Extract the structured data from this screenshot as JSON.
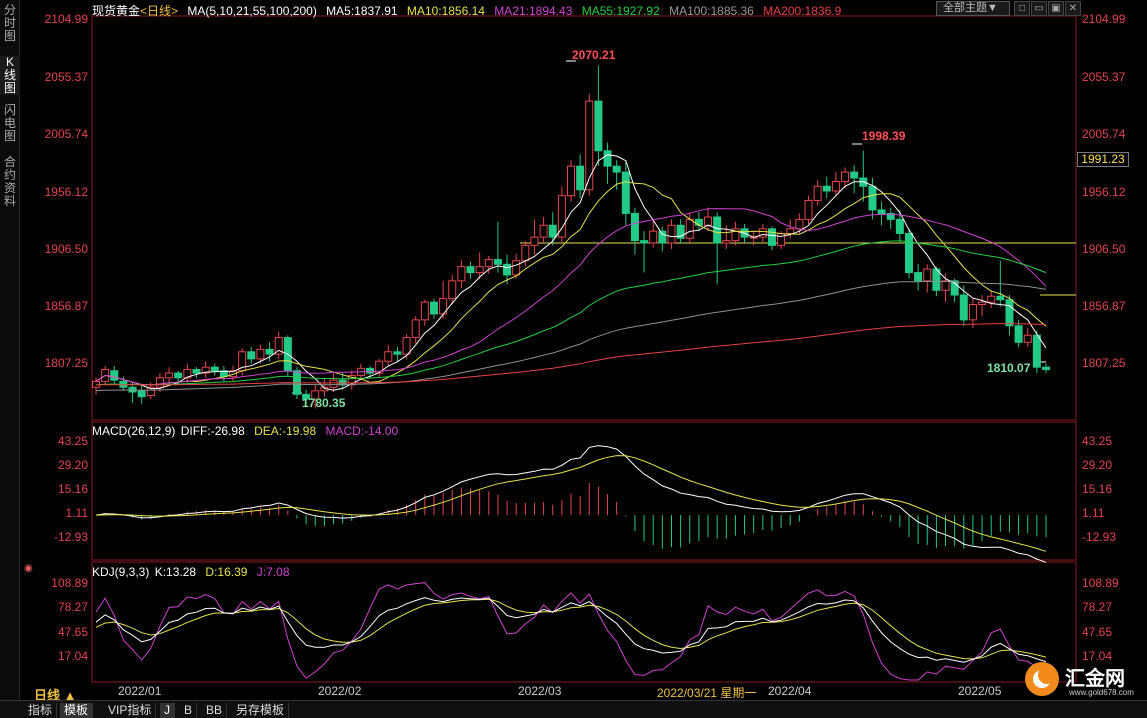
{
  "sidebar": {
    "tabs": [
      {
        "label": "分时图",
        "active": false
      },
      {
        "label": "K线图",
        "active": true
      },
      {
        "label": "闪电图",
        "active": false
      },
      {
        "label": "合约资料",
        "active": false
      }
    ]
  },
  "header": {
    "symbol": "现货黄金",
    "period": "<日线>",
    "ma_params": "MA(5,10,21,55,100,200)",
    "ma5": "MA5:1837.91",
    "ma10": "MA10:1856.14",
    "ma21": "MA21:1894.43",
    "ma55": "MA55:1927.92",
    "ma100": "MA100:1885.36",
    "ma200": "MA200:1836.9",
    "theme_button": "全部主题▼",
    "window_buttons": [
      "□",
      "▭",
      "▣",
      "✕"
    ]
  },
  "colors": {
    "up": "#e8464a",
    "down": "#22c987",
    "ma5": "#ffffff",
    "ma10": "#e6e24a",
    "ma21": "#d040d0",
    "ma55": "#22d040",
    "ma100": "#909090",
    "ma200": "#e84040"
  },
  "price_axis": {
    "ticks": [
      "2104.99",
      "2055.37",
      "2005.74",
      "1956.12",
      "1906.50",
      "1856.87",
      "1807.25"
    ],
    "current_price": "1991.23"
  },
  "annotations": {
    "high": "2070.21",
    "high2": "1998.39",
    "low": "1780.35",
    "last_low": "1810.07"
  },
  "macd": {
    "title": "MACD(26,12,9)",
    "diff": "DIFF:-26.98",
    "dea": "DEA:-19.98",
    "macd": "MACD:-14.00",
    "ticks": [
      "43.25",
      "29.20",
      "15.16",
      "1.11",
      "-12.93"
    ]
  },
  "kdj": {
    "title": "KDJ(9,3,3)",
    "k": "K:13.28",
    "d": "D:16.39",
    "j": "J:7.08",
    "ticks": [
      "108.89",
      "78.27",
      "47.65",
      "17.04"
    ]
  },
  "x_axis": {
    "dates": [
      "2022/01",
      "2022/02",
      "2022/03",
      "2022/04",
      "2022/05"
    ],
    "crosshair": "2022/03/21 星期一"
  },
  "period_label": "日线 ▲",
  "bottom_tabs": [
    {
      "label": "指标",
      "selected": false
    },
    {
      "label": "模板",
      "selected": true
    },
    {
      "label": "VIP指标",
      "selected": false
    },
    {
      "label": "J",
      "selected": true
    },
    {
      "label": "B",
      "selected": false
    },
    {
      "label": "BB",
      "selected": false
    },
    {
      "label": "另存模板",
      "selected": false
    }
  ],
  "logo": {
    "name": "汇金网",
    "url": "www.gold678.com"
  },
  "chart_data": {
    "type": "candlestick",
    "price_range": [
      1772,
      2112
    ],
    "candles": [
      [
        1798,
        1803,
        1792,
        1806
      ],
      [
        1803,
        1813,
        1800,
        1816
      ],
      [
        1812,
        1804,
        1800,
        1816
      ],
      [
        1803,
        1798,
        1795,
        1807
      ],
      [
        1798,
        1794,
        1785,
        1802
      ],
      [
        1795,
        1790,
        1784,
        1800
      ],
      [
        1791,
        1798,
        1788,
        1802
      ],
      [
        1798,
        1806,
        1794,
        1810
      ],
      [
        1806,
        1810,
        1800,
        1815
      ],
      [
        1810,
        1806,
        1800,
        1812
      ],
      [
        1806,
        1813,
        1802,
        1818
      ],
      [
        1813,
        1810,
        1806,
        1815
      ],
      [
        1810,
        1815,
        1806,
        1820
      ],
      [
        1815,
        1812,
        1808,
        1818
      ],
      [
        1812,
        1807,
        1803,
        1816
      ],
      [
        1807,
        1812,
        1803,
        1816
      ],
      [
        1812,
        1828,
        1808,
        1831
      ],
      [
        1828,
        1822,
        1818,
        1832
      ],
      [
        1822,
        1830,
        1818,
        1834
      ],
      [
        1830,
        1826,
        1820,
        1836
      ],
      [
        1826,
        1840,
        1822,
        1845
      ],
      [
        1840,
        1812,
        1808,
        1842
      ],
      [
        1812,
        1792,
        1788,
        1815
      ],
      [
        1792,
        1788,
        1784,
        1796
      ],
      [
        1788,
        1795,
        1780,
        1800
      ],
      [
        1795,
        1798,
        1790,
        1806
      ],
      [
        1798,
        1804,
        1794,
        1810
      ],
      [
        1804,
        1800,
        1796,
        1810
      ],
      [
        1800,
        1808,
        1796,
        1812
      ],
      [
        1808,
        1814,
        1804,
        1818
      ],
      [
        1814,
        1810,
        1806,
        1816
      ],
      [
        1810,
        1820,
        1806,
        1822
      ],
      [
        1820,
        1828,
        1816,
        1834
      ],
      [
        1828,
        1826,
        1820,
        1832
      ],
      [
        1826,
        1840,
        1822,
        1843
      ],
      [
        1840,
        1855,
        1835,
        1858
      ],
      [
        1855,
        1870,
        1850,
        1872
      ],
      [
        1870,
        1860,
        1856,
        1873
      ],
      [
        1860,
        1873,
        1856,
        1888
      ],
      [
        1873,
        1888,
        1868,
        1893
      ],
      [
        1888,
        1900,
        1882,
        1906
      ],
      [
        1900,
        1895,
        1890,
        1904
      ],
      [
        1895,
        1900,
        1890,
        1912
      ],
      [
        1900,
        1906,
        1894,
        1909
      ],
      [
        1906,
        1902,
        1895,
        1938
      ],
      [
        1902,
        1893,
        1885,
        1910
      ],
      [
        1893,
        1905,
        1890,
        1911
      ],
      [
        1905,
        1918,
        1900,
        1922
      ],
      [
        1918,
        1925,
        1910,
        1940
      ],
      [
        1925,
        1935,
        1920,
        1942
      ],
      [
        1935,
        1925,
        1918,
        1946
      ],
      [
        1925,
        1960,
        1920,
        1968
      ],
      [
        1960,
        1985,
        1955,
        1990
      ],
      [
        1985,
        1965,
        1958,
        1995
      ],
      [
        1965,
        2040,
        1960,
        2046
      ],
      [
        2040,
        1998,
        1985,
        2070
      ],
      [
        1998,
        1985,
        1970,
        2005
      ],
      [
        1985,
        1980,
        1965,
        1990
      ],
      [
        1980,
        1945,
        1935,
        1990
      ],
      [
        1945,
        1922,
        1910,
        1950
      ],
      [
        1922,
        1920,
        1895,
        1930
      ],
      [
        1920,
        1930,
        1916,
        1940
      ],
      [
        1930,
        1920,
        1913,
        1934
      ],
      [
        1920,
        1935,
        1915,
        1940
      ],
      [
        1935,
        1924,
        1920,
        1940
      ],
      [
        1924,
        1940,
        1920,
        1946
      ],
      [
        1940,
        1935,
        1930,
        1946
      ],
      [
        1935,
        1942,
        1930,
        1950
      ],
      [
        1942,
        1920,
        1885,
        1946
      ],
      [
        1920,
        1922,
        1915,
        1935
      ],
      [
        1922,
        1932,
        1918,
        1938
      ],
      [
        1932,
        1925,
        1920,
        1936
      ],
      [
        1925,
        1925,
        1918,
        1930
      ],
      [
        1925,
        1932,
        1920,
        1936
      ],
      [
        1932,
        1918,
        1914,
        1934
      ],
      [
        1918,
        1928,
        1915,
        1930
      ],
      [
        1928,
        1932,
        1924,
        1940
      ],
      [
        1932,
        1940,
        1928,
        1945
      ],
      [
        1940,
        1956,
        1936,
        1960
      ],
      [
        1956,
        1968,
        1952,
        1973
      ],
      [
        1968,
        1964,
        1958,
        1976
      ],
      [
        1964,
        1972,
        1960,
        1980
      ],
      [
        1972,
        1980,
        1966,
        1984
      ],
      [
        1980,
        1975,
        1962,
        1986
      ],
      [
        1975,
        1968,
        1955,
        1998
      ],
      [
        1968,
        1948,
        1940,
        1975
      ],
      [
        1948,
        1945,
        1935,
        1955
      ],
      [
        1945,
        1940,
        1932,
        1950
      ],
      [
        1940,
        1928,
        1920,
        1948
      ],
      [
        1928,
        1895,
        1890,
        1932
      ],
      [
        1895,
        1888,
        1880,
        1902
      ],
      [
        1888,
        1898,
        1878,
        1902
      ],
      [
        1898,
        1880,
        1875,
        1900
      ],
      [
        1880,
        1888,
        1870,
        1894
      ],
      [
        1888,
        1876,
        1870,
        1890
      ],
      [
        1876,
        1855,
        1850,
        1884
      ],
      [
        1855,
        1868,
        1848,
        1874
      ],
      [
        1868,
        1870,
        1858,
        1876
      ],
      [
        1870,
        1875,
        1865,
        1880
      ],
      [
        1875,
        1872,
        1866,
        1905
      ],
      [
        1872,
        1850,
        1842,
        1876
      ],
      [
        1850,
        1836,
        1832,
        1855
      ],
      [
        1836,
        1842,
        1832,
        1848
      ],
      [
        1842,
        1815,
        1810,
        1846
      ],
      [
        1815,
        1813,
        1810,
        1818
      ]
    ]
  }
}
